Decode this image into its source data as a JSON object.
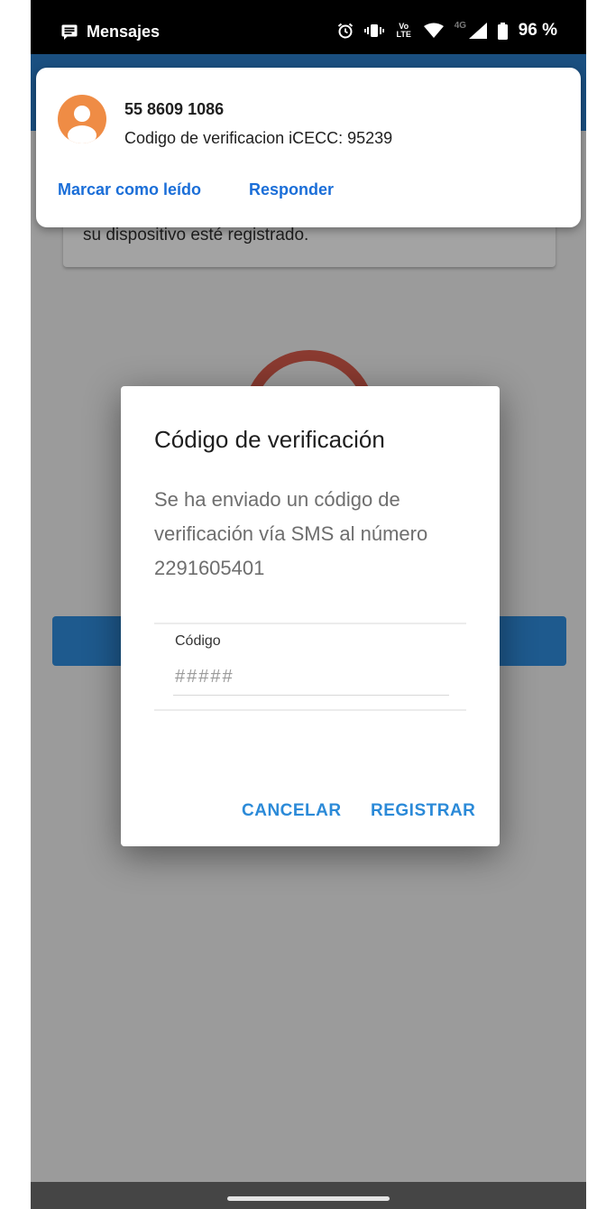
{
  "status_bar": {
    "app_name": "Mensajes",
    "app_icon": "message-icon",
    "icons": [
      "alarm-icon",
      "vibrate-icon",
      "volte-icon",
      "wifi-icon",
      "mobile-data-icon",
      "signal-icon",
      "battery-icon"
    ],
    "volte_top": "Vo",
    "volte_bottom": "LTE",
    "network_label": "4G",
    "battery_percent": "96 %"
  },
  "background_app": {
    "card_text": "su dispositivo esté registrado."
  },
  "notification": {
    "avatar_icon": "person-icon",
    "avatar_color": "#ef8c45",
    "sender": "55 8609 1086",
    "message": "Codigo de verificacion iCECC: 95239",
    "actions": [
      "Marcar como leído",
      "Responder"
    ]
  },
  "dialog": {
    "title": "Código de verificación",
    "message": "Se ha enviado un código de verificación vía SMS al número 2291605401",
    "field_label": "Código",
    "field_placeholder": "#####",
    "field_value": "",
    "cancel_label": "CANCELAR",
    "confirm_label": "REGISTRAR"
  },
  "colors": {
    "accent": "#2b8ad8",
    "notification_action": "#1a6ed8",
    "app_bar": "#1a4f80"
  }
}
